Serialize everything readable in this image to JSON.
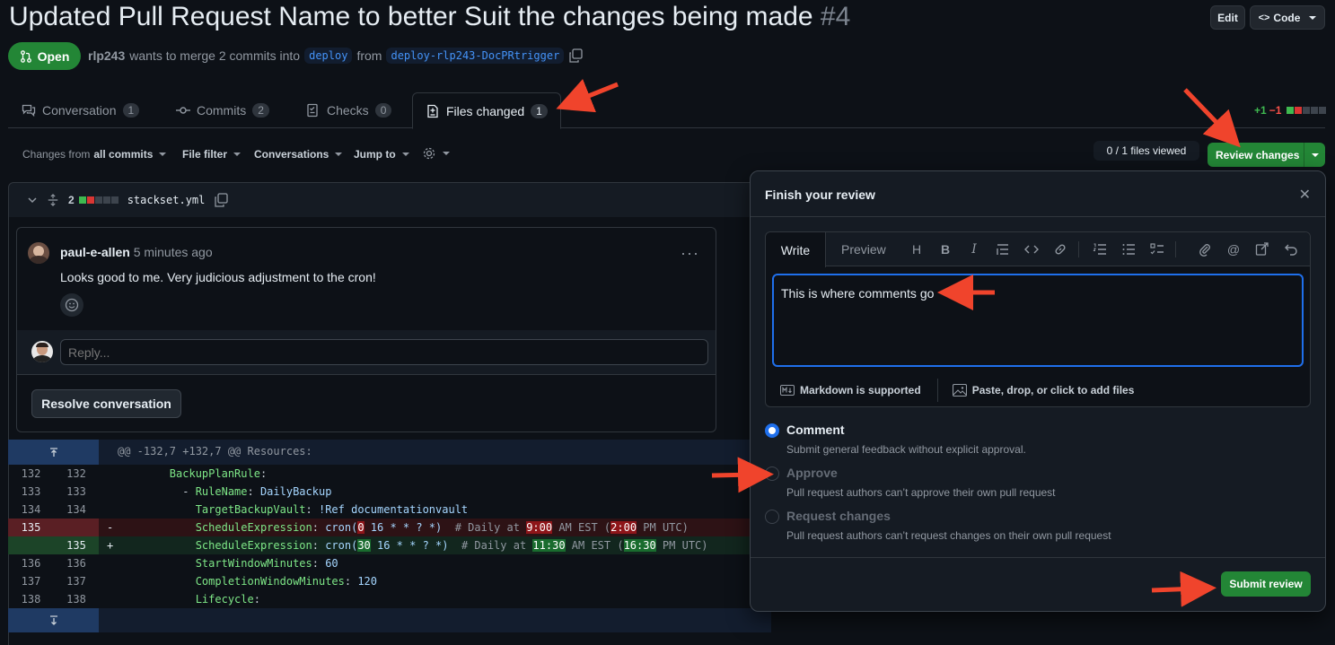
{
  "header": {
    "title": "Updated Pull Request Name to better Suit the changes being made",
    "number": "#4",
    "edit_label": "Edit",
    "code_label": "Code",
    "status_label": "Open",
    "author": "rlp243",
    "merge_text": "wants to merge 2 commits into",
    "base_branch": "deploy",
    "from_text": "from",
    "head_branch": "deploy-rlp243-DocPRtrigger"
  },
  "tabs": [
    {
      "label": "Conversation",
      "count": "1"
    },
    {
      "label": "Commits",
      "count": "2"
    },
    {
      "label": "Checks",
      "count": "0"
    },
    {
      "label": "Files changed",
      "count": "1"
    }
  ],
  "diffstat": {
    "additions": "+1",
    "deletions": "−1"
  },
  "toolbar": {
    "changes_prefix": "Changes from",
    "changes_value": "all commits",
    "file_filter": "File filter",
    "conversations": "Conversations",
    "jump_to": "Jump to",
    "files_viewed": "0 / 1 files viewed",
    "review_changes": "Review changes"
  },
  "file": {
    "change_count": "2",
    "filename": "stackset.yml"
  },
  "comment": {
    "author": "paul-e-allen",
    "time": "5 minutes ago",
    "body": "Looks good to me. Very judicious adjustment to the cron!",
    "reply_placeholder": "Reply...",
    "resolve_label": "Resolve conversation"
  },
  "diff": {
    "hunk_header": "@@ -132,7 +132,7 @@ Resources:"
  },
  "review_panel": {
    "title": "Finish your review",
    "write_tab": "Write",
    "preview_tab": "Preview",
    "comment_text": "This is where comments go",
    "markdown_note": "Markdown is supported",
    "attach_note": "Paste, drop, or click to add files",
    "options": [
      {
        "label": "Comment",
        "desc": "Submit general feedback without explicit approval."
      },
      {
        "label": "Approve",
        "desc": "Pull request authors can’t approve their own pull request"
      },
      {
        "label": "Request changes",
        "desc": "Pull request authors can’t request changes on their own pull request"
      }
    ],
    "submit_label": "Submit review"
  },
  "colors": {
    "accent_green": "#238636",
    "accent_blue": "#1f6feb",
    "annotation_arrow": "#f0442c"
  }
}
